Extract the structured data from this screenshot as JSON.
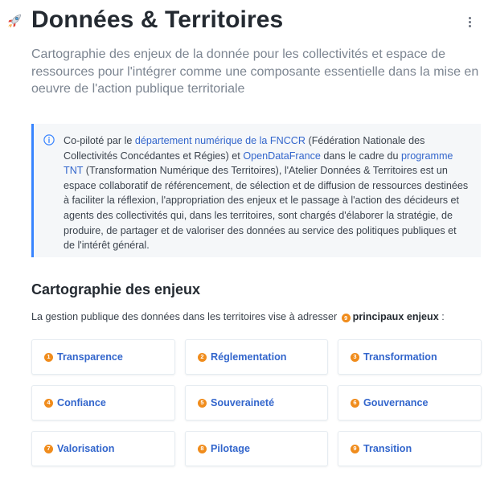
{
  "header": {
    "title": "Données & Territoires",
    "subtitle": "Cartographie des enjeux de la donnée pour les collectivités et espace de ressources pour l'intégrer comme une composante essentielle dans la mise en oeuvre de l'action publique territoriale",
    "rocket_icon": "rocket-icon",
    "menu_icon": "kebab-menu-icon"
  },
  "hint": {
    "icon": "info-icon",
    "text_1": "Co-piloté par le ",
    "link_1": "département numérique de la FNCCR",
    "text_2": " (Fédération Nationale des Collectivités Concédantes et Régies) et ",
    "link_2": "OpenDataFrance",
    "text_3": " dans le cadre du ",
    "link_3": "programme TNT",
    "text_4": " (Transformation Numérique des Territoires), l'Atelier Données & Territoires est un espace collaboratif de référencement, de sélection et de diffusion de ressources destinées à faciliter la réflexion, l'appropriation des enjeux et le passage à l'action des décideurs et agents des collectivités qui, dans les territoires, sont chargés d'élaborer la stratégie, de produire, de partager et de valoriser des données au service des politiques publiques et de l'intérêt général."
  },
  "section": {
    "title": "Cartographie des enjeux",
    "intro_before": "La gestion publique des données dans les territoires vise à adresser ",
    "intro_count": "9",
    "intro_bold": "principaux enjeux",
    "intro_after": " :"
  },
  "cards": [
    {
      "number": "1",
      "label": "Transparence"
    },
    {
      "number": "2",
      "label": "Réglementation"
    },
    {
      "number": "3",
      "label": "Transformation"
    },
    {
      "number": "4",
      "label": "Confiance"
    },
    {
      "number": "5",
      "label": "Souveraineté"
    },
    {
      "number": "6",
      "label": "Gouvernance"
    },
    {
      "number": "7",
      "label": "Valorisation"
    },
    {
      "number": "8",
      "label": "Pilotage"
    },
    {
      "number": "9",
      "label": "Transition"
    }
  ],
  "colors": {
    "accent_link": "#3366cc",
    "hint_border": "#3884ff",
    "hint_background": "#f5f7f9",
    "badge": "#f08c1c"
  }
}
